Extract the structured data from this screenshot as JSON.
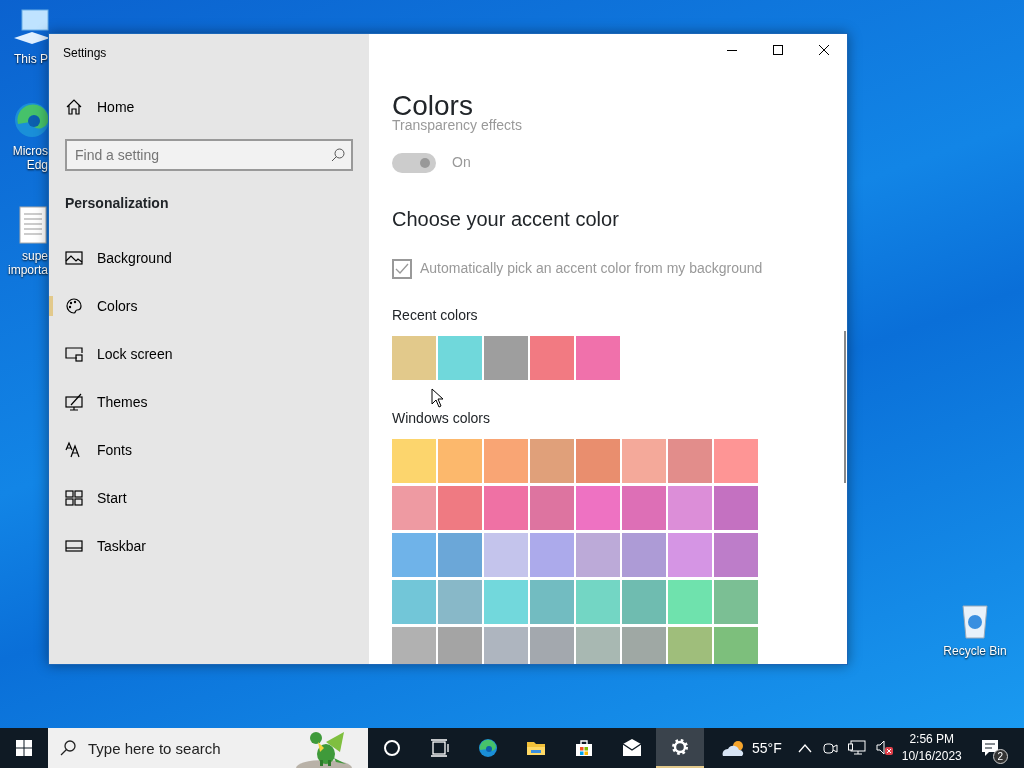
{
  "desktop": {
    "icons": [
      {
        "kind": "pc",
        "lines": [
          "This P"
        ]
      },
      {
        "kind": "edge",
        "lines": [
          "Micros",
          "Edg"
        ]
      },
      {
        "kind": "document",
        "lines": [
          "supe",
          "importa"
        ]
      },
      {
        "kind": "recycle",
        "lines": [
          "Recycle Bin"
        ]
      }
    ]
  },
  "window": {
    "title": "Settings"
  },
  "sidebar": {
    "home": "Home",
    "search": {
      "placeholder": "Find a setting"
    },
    "section": "Personalization",
    "items": [
      {
        "kind": "background",
        "label": "Background",
        "selected": false
      },
      {
        "kind": "colors",
        "label": "Colors",
        "selected": true
      },
      {
        "kind": "lock",
        "label": "Lock screen",
        "selected": false
      },
      {
        "kind": "themes",
        "label": "Themes",
        "selected": false
      },
      {
        "kind": "fonts",
        "label": "Fonts",
        "selected": false
      },
      {
        "kind": "start",
        "label": "Start",
        "selected": false
      },
      {
        "kind": "taskbar",
        "label": "Taskbar",
        "selected": false
      }
    ]
  },
  "content": {
    "title": "Colors",
    "transparency": {
      "label": "Transparency effects",
      "on": true,
      "disabled": true,
      "state_text": "On"
    },
    "accent": {
      "heading": "Choose your accent color",
      "auto_pick": {
        "label": "Automatically pick an accent color from my background",
        "checked": true,
        "disabled": true
      }
    },
    "recent_colors": {
      "label": "Recent colors",
      "swatches": [
        {
          "color": "#e2c98b"
        },
        {
          "color": "#70d8db"
        },
        {
          "color": "#9e9e9e"
        },
        {
          "color": "#f27a82"
        },
        {
          "color": "#f071ab"
        }
      ]
    },
    "windows_colors": {
      "label": "Windows colors",
      "swatches": [
        {
          "color": "#fcd56d"
        },
        {
          "color": "#fcb86c"
        },
        {
          "color": "#f9a574"
        },
        {
          "color": "#e0a07a"
        },
        {
          "color": "#e98e6e"
        },
        {
          "color": "#f4a99a"
        },
        {
          "color": "#e28d8b"
        },
        {
          "color": "#fe9595"
        },
        {
          "color": "#ee9aa2"
        },
        {
          "color": "#ef7a82"
        },
        {
          "color": "#ef71a4"
        },
        {
          "color": "#dd74a0"
        },
        {
          "color": "#ee72c2"
        },
        {
          "color": "#dd6fb6"
        },
        {
          "color": "#dc8ed8"
        },
        {
          "color": "#c471c1"
        },
        {
          "color": "#6fb3e9"
        },
        {
          "color": "#6ba7d8"
        },
        {
          "color": "#c4c4ec"
        },
        {
          "color": "#acaaeb"
        },
        {
          "color": "#bcaad8"
        },
        {
          "color": "#ad9bd6"
        },
        {
          "color": "#d595e4"
        },
        {
          "color": "#bd7dc9"
        },
        {
          "color": "#72c6d8"
        },
        {
          "color": "#88b8c8"
        },
        {
          "color": "#72d8dc"
        },
        {
          "color": "#72bcc1"
        },
        {
          "color": "#73d6c4"
        },
        {
          "color": "#6fbcb0"
        },
        {
          "color": "#6fe2ad"
        },
        {
          "color": "#7bbf94"
        },
        {
          "color": "#b1b1b1"
        },
        {
          "color": "#a4a4a4"
        },
        {
          "color": "#aeb5bf"
        },
        {
          "color": "#a3a8ae"
        },
        {
          "color": "#a8b8b2"
        },
        {
          "color": "#9fa8a4"
        },
        {
          "color": "#9fbe7b"
        },
        {
          "color": "#7dbf7c"
        }
      ]
    }
  },
  "taskbar": {
    "search": {
      "placeholder": "Type here to search"
    },
    "apps": [
      {
        "kind": "cortana",
        "active": false
      },
      {
        "kind": "taskview",
        "active": false
      },
      {
        "kind": "edge",
        "active": false
      },
      {
        "kind": "explorer",
        "active": false
      },
      {
        "kind": "store",
        "active": false
      },
      {
        "kind": "mail",
        "active": false
      },
      {
        "kind": "settings",
        "active": true
      }
    ],
    "weather": "55°F",
    "clock": {
      "time": "2:56 PM",
      "date": "10/16/2023"
    },
    "notifications": {
      "count": "2"
    }
  }
}
